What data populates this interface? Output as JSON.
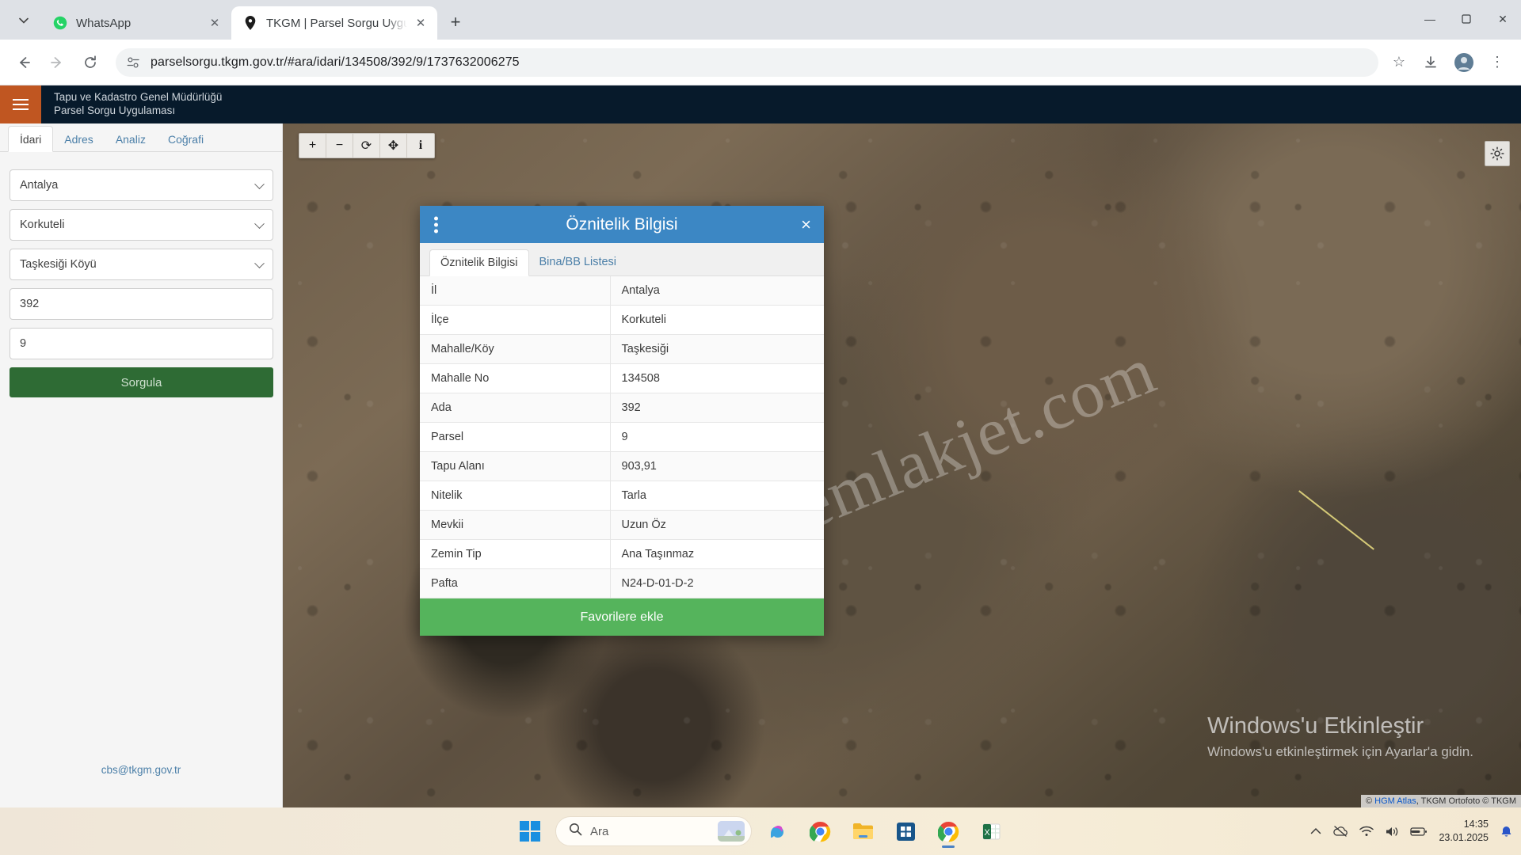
{
  "browser": {
    "tabs": [
      {
        "title": "WhatsApp",
        "icon": "whatsapp-icon",
        "active": false
      },
      {
        "title": "TKGM | Parsel Sorgu Uygulamas",
        "icon": "map-pin-icon",
        "active": true
      }
    ],
    "new_tab_label": "+",
    "tab_list_chevron": "⌄",
    "window_controls": {
      "minimize": "—",
      "maximize": "❐",
      "close": "✕"
    },
    "nav": {
      "back": "←",
      "forward": "→",
      "reload": "⟳"
    },
    "url": "parselsorgu.tkgm.gov.tr/#ara/idari/134508/392/9/1737632006275",
    "right_icons": {
      "bookmark": "☆",
      "download": "download-icon",
      "extensions": "extensions-icon",
      "menu": "⋮"
    }
  },
  "app": {
    "header": {
      "line1": "Tapu ve Kadastro Genel Müdürlüğü",
      "line2": "Parsel Sorgu Uygulaması"
    },
    "sidebar": {
      "tabs": [
        {
          "label": "İdari",
          "active": true
        },
        {
          "label": "Adres",
          "active": false
        },
        {
          "label": "Analiz",
          "active": false
        },
        {
          "label": "Coğrafi",
          "active": false
        }
      ],
      "fields": [
        {
          "name": "il",
          "value": "Antalya",
          "type": "select"
        },
        {
          "name": "ilce",
          "value": "Korkuteli",
          "type": "select"
        },
        {
          "name": "mahalle",
          "value": "Taşkesiği Köyü",
          "type": "select"
        },
        {
          "name": "ada",
          "value": "392",
          "type": "text"
        },
        {
          "name": "parsel",
          "value": "9",
          "type": "text"
        }
      ],
      "submit_label": "Sorgula",
      "contact_mail": "cbs@tkgm.gov.tr"
    },
    "map": {
      "tools": [
        "+",
        "−",
        "⟳",
        "✥",
        "i"
      ],
      "settings_icon": "gear-icon",
      "watermark": "emlakjet.com",
      "attribution_prefix": "© ",
      "attribution_link": "HGM Atlas",
      "attribution_rest": ", TKGM Ortofoto © TKGM"
    },
    "modal": {
      "title": "Öznitelik Bilgisi",
      "kebab_icon": "more-vertical-icon",
      "close_icon": "×",
      "tabs": [
        {
          "label": "Öznitelik Bilgisi",
          "active": true
        },
        {
          "label": "Bina/BB Listesi",
          "active": false
        }
      ],
      "rows": [
        {
          "key": "İl",
          "value": "Antalya"
        },
        {
          "key": "İlçe",
          "value": "Korkuteli"
        },
        {
          "key": "Mahalle/Köy",
          "value": "Taşkesiği"
        },
        {
          "key": "Mahalle No",
          "value": "134508"
        },
        {
          "key": "Ada",
          "value": "392"
        },
        {
          "key": "Parsel",
          "value": "9"
        },
        {
          "key": "Tapu Alanı",
          "value": "903,91"
        },
        {
          "key": "Nitelik",
          "value": "Tarla"
        },
        {
          "key": "Mevkii",
          "value": "Uzun Öz"
        },
        {
          "key": "Zemin Tip",
          "value": "Ana Taşınmaz"
        },
        {
          "key": "Pafta",
          "value": "N24-D-01-D-2"
        }
      ],
      "favorite_label": "Favorilere ekle"
    }
  },
  "windows": {
    "activate_title": "Windows'u Etkinleştir",
    "activate_sub": "Windows'u etkinleştirmek için Ayarlar'a gidin.",
    "taskbar": {
      "search_placeholder": "Ara",
      "search_icon": "search-icon",
      "start_icon": "windows-logo-icon",
      "apps": [
        "copilot-icon",
        "chrome-icon",
        "file-explorer-icon",
        "microsoft-store-icon",
        "chrome-active-icon",
        "excel-icon"
      ],
      "tray": [
        "chevron-up-icon",
        "onedrive-off-icon",
        "wifi-icon",
        "volume-icon",
        "battery-icon"
      ],
      "time": "14:35",
      "date": "23.01.2025",
      "notification_icon": "bell-icon"
    }
  }
}
